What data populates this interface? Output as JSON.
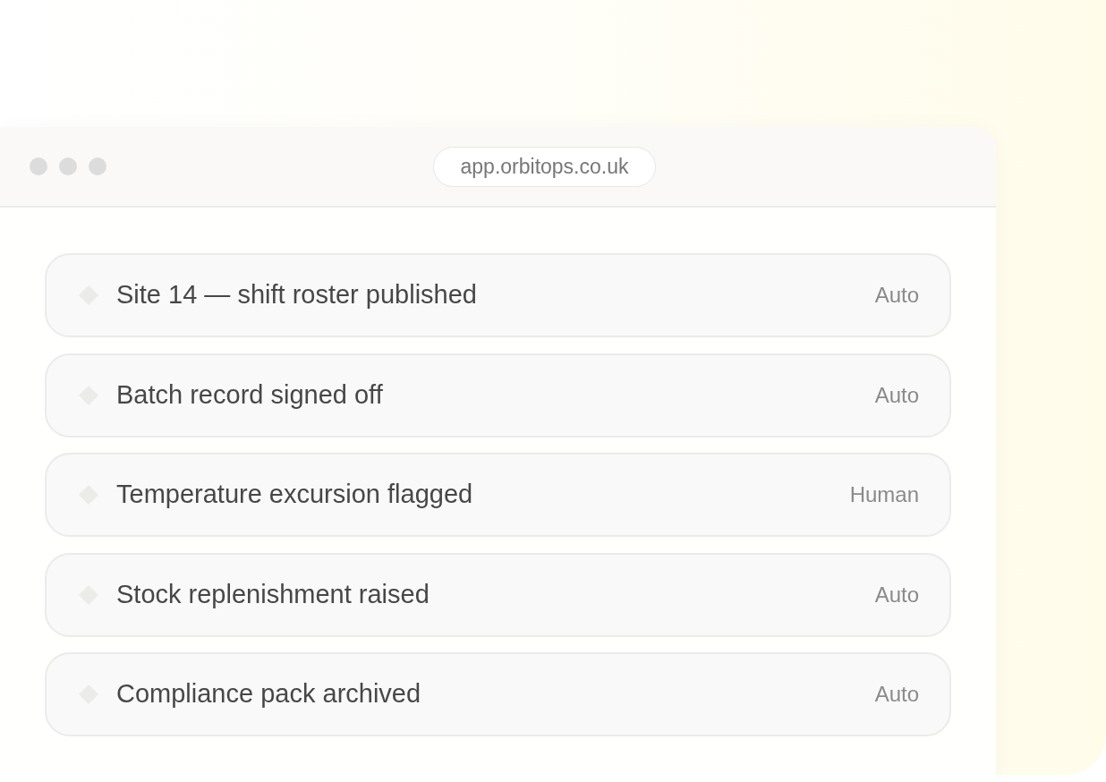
{
  "window": {
    "url": "app.orbitops.co.uk"
  },
  "rows": [
    {
      "title": "Site 14 — shift roster published",
      "mode": "Auto"
    },
    {
      "title": "Batch record signed off",
      "mode": "Auto"
    },
    {
      "title": "Temperature excursion flagged",
      "mode": "Human"
    },
    {
      "title": "Stock replenishment raised",
      "mode": "Auto"
    },
    {
      "title": "Compliance pack archived",
      "mode": "Auto"
    }
  ]
}
